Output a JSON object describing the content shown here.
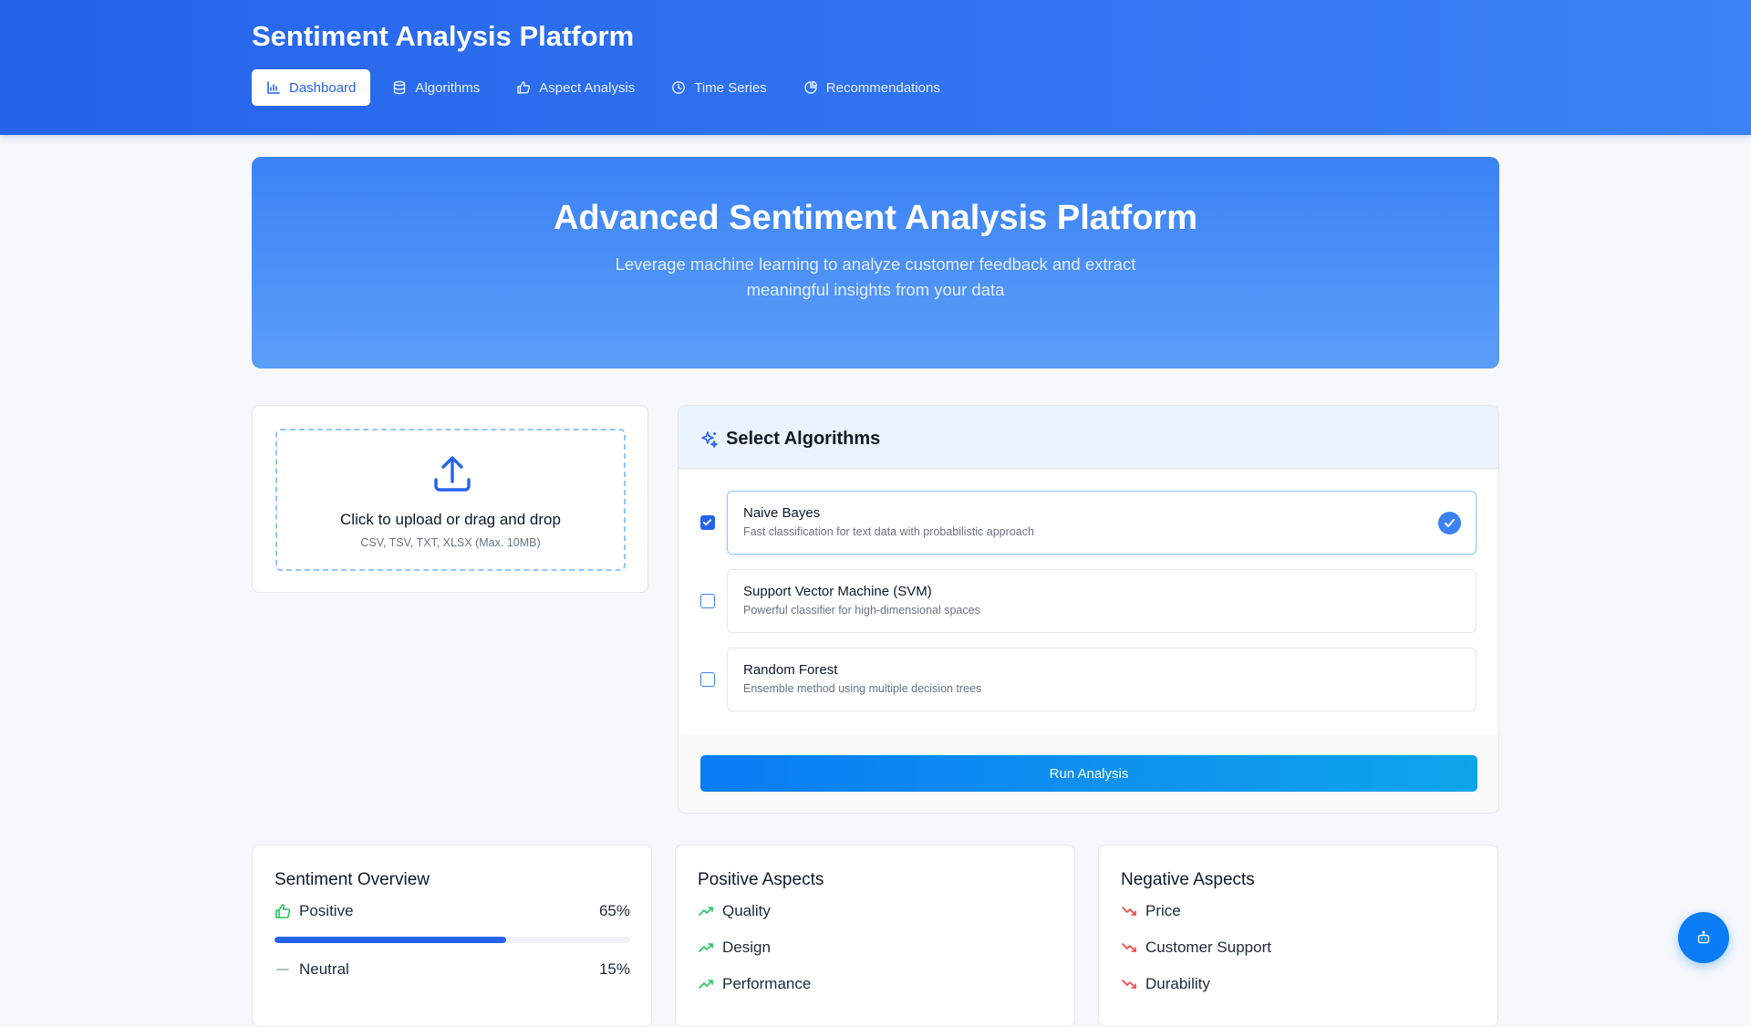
{
  "app": {
    "title": "Sentiment Analysis Platform"
  },
  "nav": {
    "items": [
      {
        "label": "Dashboard",
        "icon": "bar-chart-icon",
        "active": true
      },
      {
        "label": "Algorithms",
        "icon": "database-icon"
      },
      {
        "label": "Aspect Analysis",
        "icon": "thumbs-up-icon"
      },
      {
        "label": "Time Series",
        "icon": "clock-icon"
      },
      {
        "label": "Recommendations",
        "icon": "pie-chart-icon"
      }
    ]
  },
  "hero": {
    "title": "Advanced Sentiment Analysis Platform",
    "subtitle": "Leverage machine learning to analyze customer feedback and extract meaningful insights from your data"
  },
  "upload": {
    "main_text": "Click to upload or drag and drop",
    "hint": "CSV, TSV, TXT, XLSX (Max. 10MB)",
    "icon": "upload-icon"
  },
  "algorithms": {
    "title": "Select Algorithms",
    "icon": "sparkles-icon",
    "items": [
      {
        "name": "Naive Bayes",
        "description": "Fast classification for text data with probabilistic approach",
        "checked": true
      },
      {
        "name": "Support Vector Machine (SVM)",
        "description": "Powerful classifier for high-dimensional spaces",
        "checked": false
      },
      {
        "name": "Random Forest",
        "description": "Ensemble method using multiple decision trees",
        "checked": false
      }
    ],
    "run_label": "Run Analysis"
  },
  "overview": {
    "title": "Sentiment Overview",
    "items": [
      {
        "label": "Positive",
        "value": "65%",
        "fraction": 0.65,
        "icon": "thumbs-up-icon",
        "color": "#22c55e"
      },
      {
        "label": "Neutral",
        "value": "15%",
        "fraction": 0.15,
        "icon": "minus-icon",
        "color": "#9ca3af"
      }
    ]
  },
  "positive_aspects": {
    "title": "Positive Aspects",
    "items": [
      "Quality",
      "Design",
      "Performance"
    ],
    "icon": "trending-up-icon",
    "color": "#22c55e"
  },
  "negative_aspects": {
    "title": "Negative Aspects",
    "items": [
      "Price",
      "Customer Support",
      "Durability"
    ],
    "icon": "trending-down-icon",
    "color": "#ef4444"
  },
  "colors": {
    "primary": "#2563eb",
    "accent": "#0ea5e9"
  },
  "fab": {
    "icon": "robot-icon"
  }
}
